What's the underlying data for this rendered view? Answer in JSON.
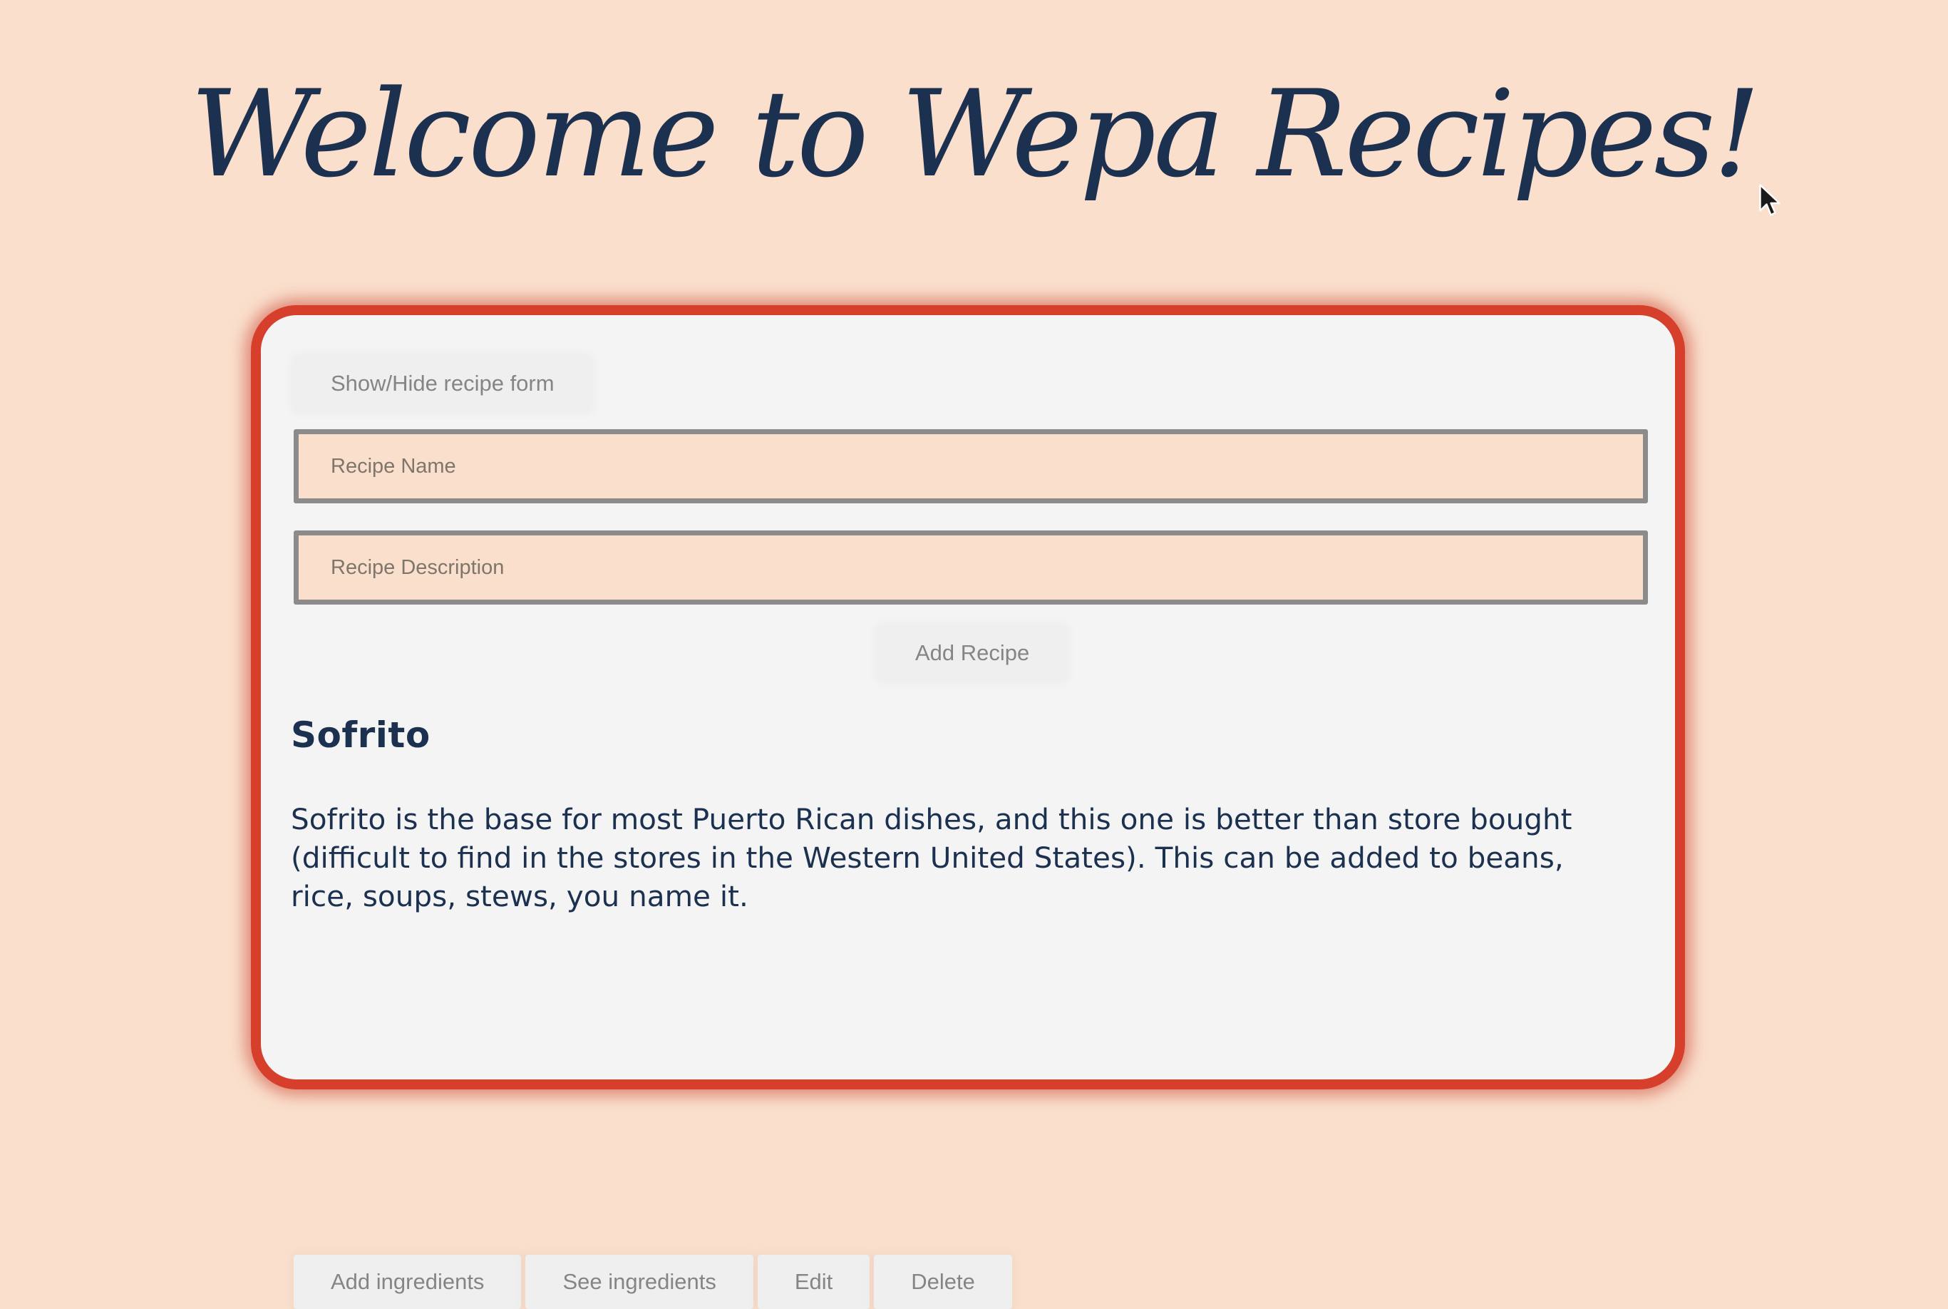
{
  "header": {
    "title": "Welcome to Wepa Recipes!"
  },
  "form": {
    "toggle_label": "Show/Hide recipe form",
    "name_placeholder": "Recipe Name",
    "name_value": "",
    "description_placeholder": "Recipe Description",
    "description_value": "",
    "submit_label": "Add Recipe"
  },
  "recipes": [
    {
      "name": "Sofrito",
      "description": "Sofrito is the base for most Puerto Rican dishes, and this one is better than store bought (difficult to find in the stores in the Western United States). This can be added to beans, rice, soups, stews, you name it.",
      "actions": {
        "add_ingredients": "Add ingredients",
        "see_ingredients": "See ingredients",
        "edit": "Edit",
        "delete": "Delete"
      }
    }
  ],
  "colors": {
    "page_background": "#fadfcd",
    "card_border": "#d63f2c",
    "card_background": "#f4f4f4",
    "heading_text": "#1c3150",
    "button_text": "#858585",
    "input_background": "#fadfcd",
    "input_border": "#8b8b8b"
  },
  "icons": {
    "cursor": "mouse-pointer-icon"
  }
}
